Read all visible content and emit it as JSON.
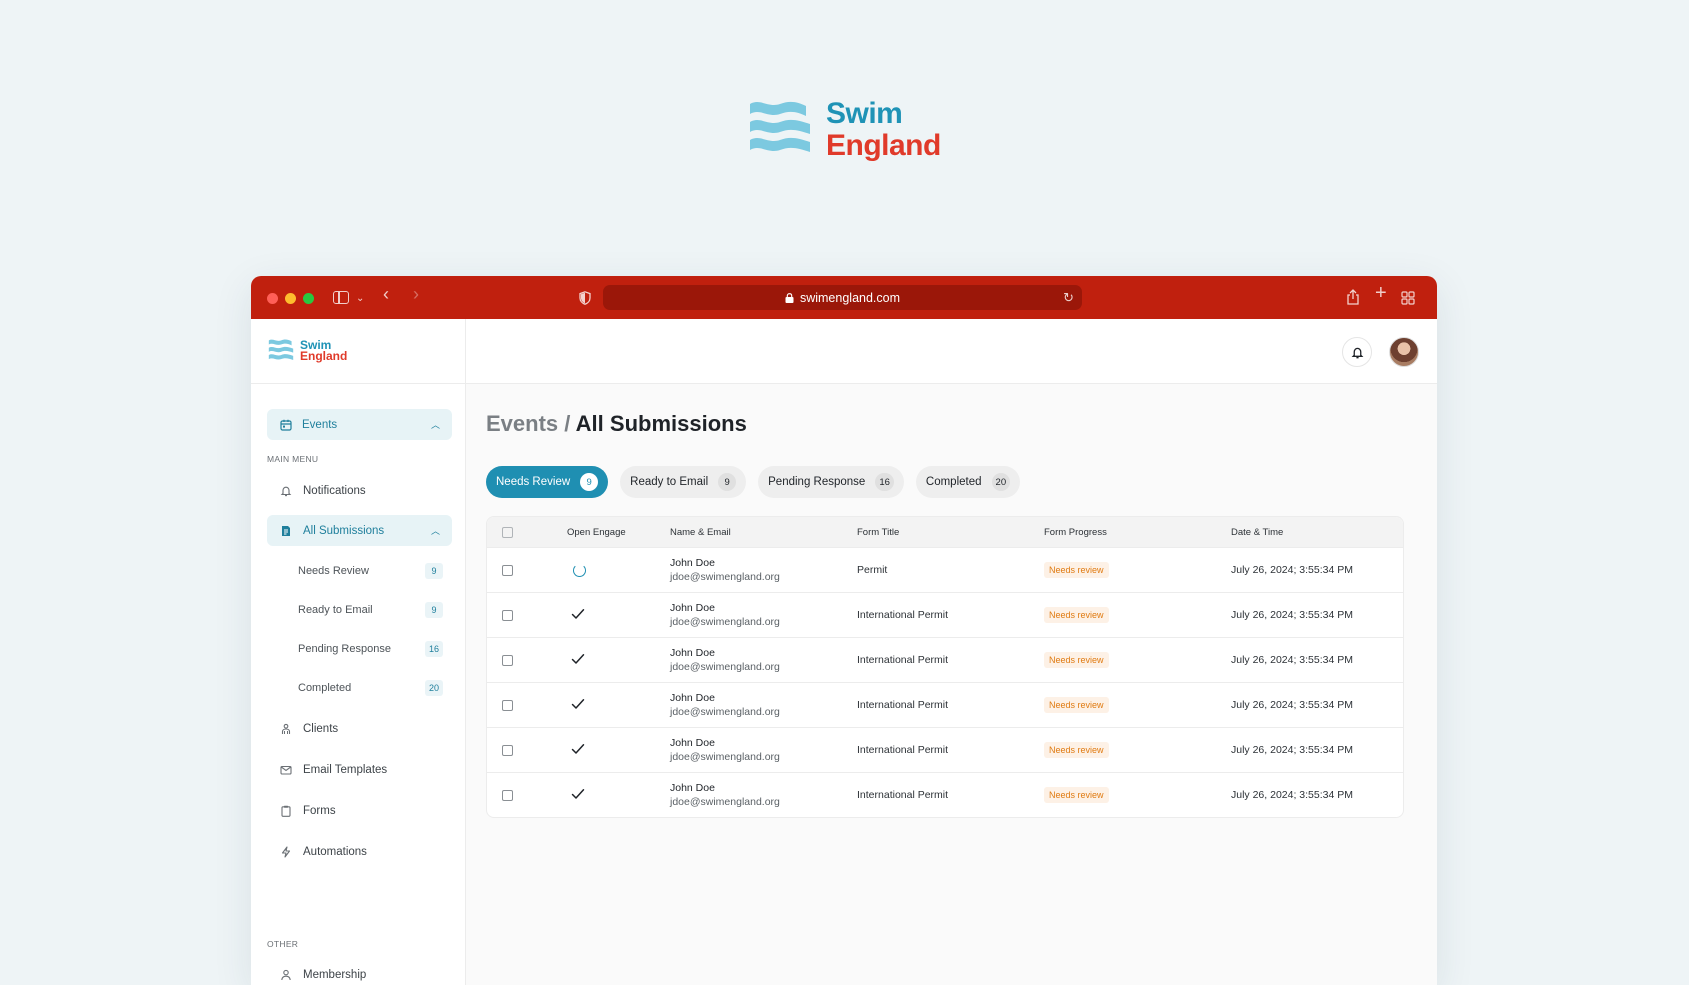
{
  "hero": {
    "brand_line1": "Swim",
    "brand_line2": "England"
  },
  "browser": {
    "url": "swimengland.com"
  },
  "sidebar": {
    "brand_line1": "Swim",
    "brand_line2": "England",
    "events_label": "Events",
    "main_menu_label": "MAIN MENU",
    "notifications_label": "Notifications",
    "all_submissions_label": "All Submissions",
    "sub_items": [
      {
        "label": "Needs Review",
        "count": "9"
      },
      {
        "label": "Ready to Email",
        "count": "9"
      },
      {
        "label": "Pending Response",
        "count": "16"
      },
      {
        "label": "Completed",
        "count": "20"
      }
    ],
    "clients_label": "Clients",
    "email_templates_label": "Email Templates",
    "forms_label": "Forms",
    "automations_label": "Automations",
    "other_label": "OTHER",
    "membership_label": "Membership"
  },
  "page": {
    "crumb": "Events /",
    "title": "All Submissions"
  },
  "filter_tabs": [
    {
      "label": "Needs Review",
      "count": "9"
    },
    {
      "label": "Ready to Email",
      "count": "9"
    },
    {
      "label": "Pending Response",
      "count": "16"
    },
    {
      "label": "Completed",
      "count": "20"
    }
  ],
  "table": {
    "headers": {
      "open_engage": "Open Engage",
      "name_email": "Name & Email",
      "form_title": "Form Title",
      "form_progress": "Form Progress",
      "date_time": "Date & Time"
    },
    "rows": [
      {
        "engage": "loading",
        "name": "John Doe",
        "email": "jdoe@swimengland.org",
        "form": "Permit",
        "progress": "Needs review",
        "date": "July 26, 2024; 3:55:34 PM"
      },
      {
        "engage": "done",
        "name": "John Doe",
        "email": "jdoe@swimengland.org",
        "form": "International Permit",
        "progress": "Needs review",
        "date": "July 26, 2024; 3:55:34 PM"
      },
      {
        "engage": "done",
        "name": "John Doe",
        "email": "jdoe@swimengland.org",
        "form": "International Permit",
        "progress": "Needs review",
        "date": "July 26, 2024; 3:55:34 PM"
      },
      {
        "engage": "done",
        "name": "John Doe",
        "email": "jdoe@swimengland.org",
        "form": "International Permit",
        "progress": "Needs review",
        "date": "July 26, 2024; 3:55:34 PM"
      },
      {
        "engage": "done",
        "name": "John Doe",
        "email": "jdoe@swimengland.org",
        "form": "International Permit",
        "progress": "Needs review",
        "date": "July 26, 2024; 3:55:34 PM"
      },
      {
        "engage": "done",
        "name": "John Doe",
        "email": "jdoe@swimengland.org",
        "form": "International Permit",
        "progress": "Needs review",
        "date": "July 26, 2024; 3:55:34 PM"
      }
    ]
  },
  "colors": {
    "brand_blue": "#1f93b6",
    "brand_red": "#e03a2a",
    "titlebar": "#c0200e",
    "accent": "#1f8fb2",
    "status_orange": "#e07b12"
  }
}
